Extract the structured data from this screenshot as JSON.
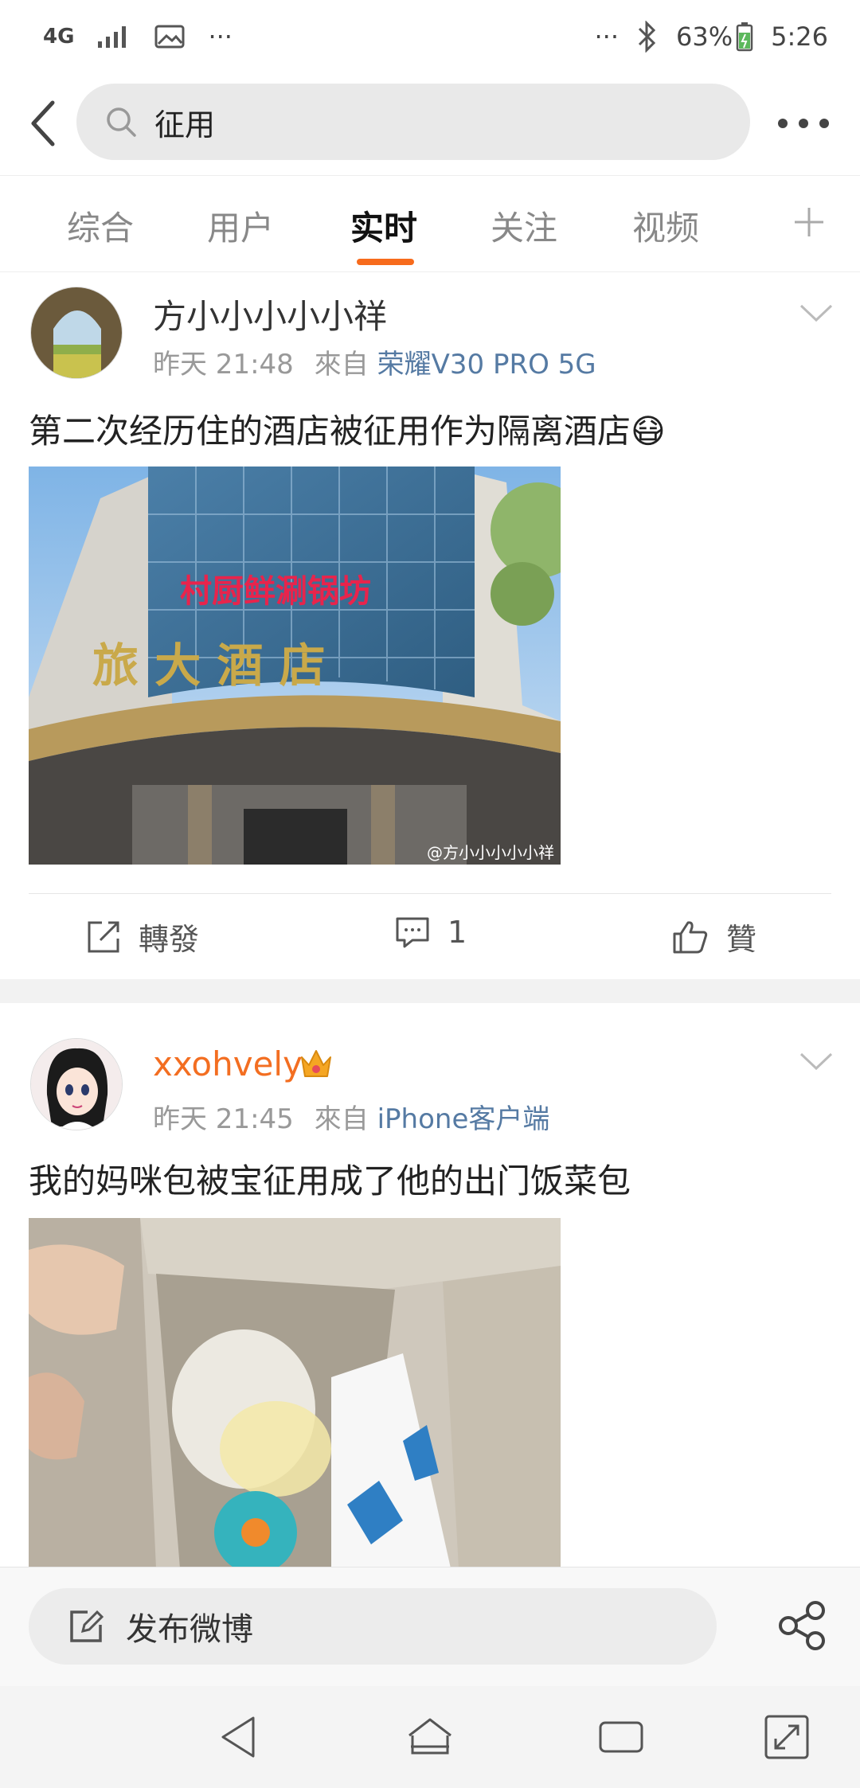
{
  "status_bar": {
    "network": "4G",
    "overflow": "···",
    "overflow_right": "···",
    "battery": "63%",
    "time": "5:26"
  },
  "search": {
    "query": "征用"
  },
  "tabs": [
    "综合",
    "用户",
    "实时",
    "关注",
    "视频"
  ],
  "active_tab": 2,
  "posts": [
    {
      "username": "方小小小小小祥",
      "time": "昨天 21:48",
      "from_label": "來自",
      "source": "荣耀V30 PRO 5G",
      "text": "第二次经历住的酒店被征用作为隔离酒店😷",
      "image_watermark": "@方小小小小小祥",
      "image_sign": "村厨鲜涮锅坊",
      "image_hotel": "旅   大   酒   店",
      "actions": {
        "repost": "轉發",
        "comment": "1",
        "like": "贊"
      }
    },
    {
      "username": "xxohvely",
      "time": "昨天 21:45",
      "from_label": "來自",
      "source": "iPhone客户端",
      "text": "我的妈咪包被宝征用成了他的出门饭菜包"
    }
  ],
  "compose": {
    "label": "发布微博"
  },
  "colors": {
    "accent": "#f76b1c",
    "source_link": "#557aa3",
    "username_vip": "#f36e21"
  }
}
